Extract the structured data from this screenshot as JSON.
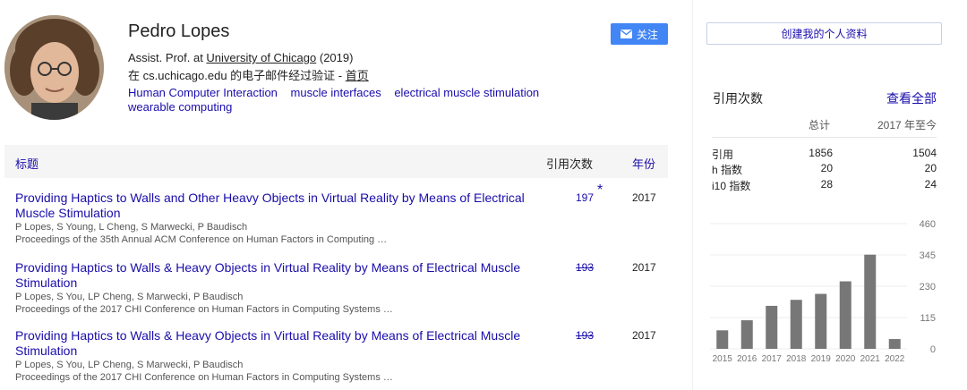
{
  "profile": {
    "name": "Pedro Lopes",
    "affiliation_prefix": "Assist. Prof. at ",
    "affiliation_link": "University of Chicago",
    "affiliation_suffix": " (2019)",
    "verified_text": "在 cs.uchicago.edu 的电子邮件经过验证 - ",
    "homepage_link": "首页",
    "interests": [
      "Human Computer Interaction",
      "muscle interfaces",
      "electrical muscle stimulation",
      "wearable computing"
    ]
  },
  "follow_button": {
    "label": "关注",
    "icon": "envelope-icon",
    "color": "#4285f4"
  },
  "table": {
    "col_title": "标题",
    "col_cites": "引用次数",
    "col_year": "年份",
    "articles": [
      {
        "title": "Providing Haptics to Walls and Other Heavy Objects in Virtual Reality by Means of Electrical Muscle Stimulation",
        "authors": "P Lopes, S Young, L Cheng, S Marwecki, P Baudisch",
        "venue": "Proceedings of the 35th Annual ACM Conference on Human Factors in Computing …",
        "cites": "197",
        "star": "*",
        "year": "2017"
      },
      {
        "title": "Providing Haptics to Walls & Heavy Objects in Virtual Reality by Means of Electrical Muscle Stimulation",
        "authors": "P Lopes, S You, LP Cheng, S Marwecki, P Baudisch",
        "venue": "Proceedings of the 2017 CHI Conference on Human Factors in Computing Systems …",
        "cites": "193",
        "year": "2017"
      },
      {
        "title": "Providing Haptics to Walls & Heavy Objects in Virtual Reality by Means of Electrical Muscle Stimulation",
        "authors": "P Lopes, S You, LP Cheng, S Marwecki, P Baudisch",
        "venue": "Proceedings of the 2017 CHI Conference on Human Factors in Computing Systems …",
        "cites": "193",
        "year": "2017"
      }
    ]
  },
  "sidebar": {
    "create_profile": "创建我的个人资料",
    "cited_by": "引用次数",
    "view_all": "查看全部",
    "col_all": "总计",
    "col_since": "2017 年至今",
    "rows": [
      {
        "label": "引用",
        "all": "1856",
        "since": "1504"
      },
      {
        "label": "h 指数",
        "all": "20",
        "since": "20"
      },
      {
        "label": "i10 指数",
        "all": "28",
        "since": "24"
      }
    ]
  },
  "chart_data": {
    "type": "bar",
    "categories": [
      "2015",
      "2016",
      "2017",
      "2018",
      "2019",
      "2020",
      "2021",
      "2022"
    ],
    "values": [
      68,
      105,
      158,
      180,
      202,
      248,
      346,
      36
    ],
    "ylim": [
      0,
      460
    ],
    "yticks": [
      "0",
      "115",
      "230",
      "345",
      "460"
    ],
    "bar_color": "#777777",
    "grid": true
  }
}
